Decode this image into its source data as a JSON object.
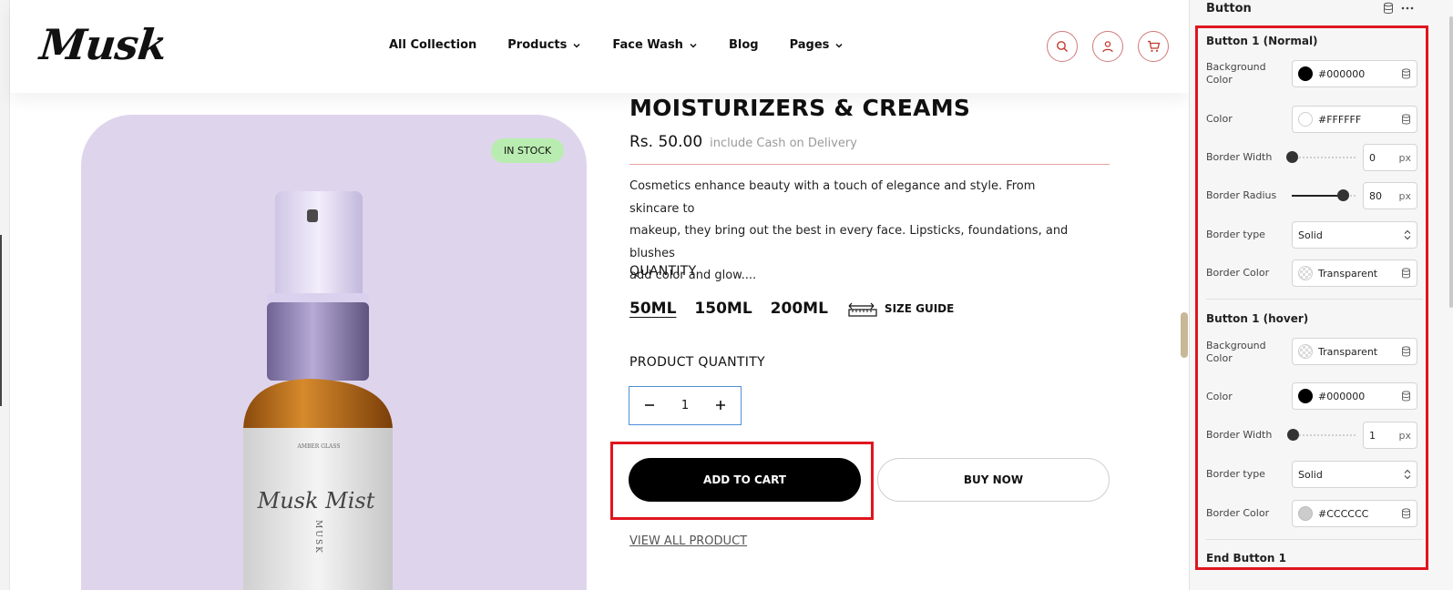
{
  "header": {
    "logo": "Musk",
    "nav": [
      {
        "label": "All Collection",
        "has_dropdown": false
      },
      {
        "label": "Products",
        "has_dropdown": true
      },
      {
        "label": "Face Wash",
        "has_dropdown": true
      },
      {
        "label": "Blog",
        "has_dropdown": false
      },
      {
        "label": "Pages",
        "has_dropdown": true
      }
    ],
    "icons": [
      "search-icon",
      "user-icon",
      "cart-icon"
    ]
  },
  "product": {
    "stock_badge": "IN STOCK",
    "title": "MOISTURIZERS & CREAMS",
    "price": "Rs. 50.00",
    "price_note": "include Cash on Delivery",
    "description_lines": [
      "Cosmetics enhance beauty with a touch of elegance and style. From skincare to",
      "makeup, they bring out the best in every face. Lipsticks, foundations, and blushes",
      "add color and glow...."
    ],
    "quantity_label": "QUANTITY",
    "sizes": [
      "50ML",
      "150ML",
      "200ML"
    ],
    "selected_size": "50ML",
    "size_guide": "SIZE GUIDE",
    "product_quantity_label": "PRODUCT QUANTITY",
    "quantity_value": "1",
    "add_to_cart": "ADD TO CART",
    "buy_now": "BUY NOW",
    "view_all": "VIEW ALL PRODUCT",
    "bottle_brand": "AMBER GLASS",
    "bottle_name": "Musk Mist",
    "bottle_vertical": "MUSK"
  },
  "panel": {
    "title": "Button",
    "normal": {
      "title": "Button 1 (Normal)",
      "background_color": {
        "label": "Background Color",
        "value": "#000000",
        "swatch": "#000000"
      },
      "color": {
        "label": "Color",
        "value": "#FFFFFF",
        "swatch": "#FFFFFF"
      },
      "border_width": {
        "label": "Border Width",
        "value": "0",
        "unit": "px",
        "level": 0
      },
      "border_radius": {
        "label": "Border Radius",
        "value": "80",
        "unit": "px",
        "level": 0.8
      },
      "border_type": {
        "label": "Border type",
        "value": "Solid"
      },
      "border_color": {
        "label": "Border Color",
        "value": "Transparent",
        "swatch": "transparent"
      }
    },
    "hover": {
      "title": "Button 1 (hover)",
      "background_color": {
        "label": "Background Color",
        "value": "Transparent",
        "swatch": "transparent"
      },
      "color": {
        "label": "Color",
        "value": "#000000",
        "swatch": "#000000"
      },
      "border_width": {
        "label": "Border Width",
        "value": "1",
        "unit": "px",
        "level": 0.01
      },
      "border_type": {
        "label": "Border type",
        "value": "Solid"
      },
      "border_color": {
        "label": "Border Color",
        "value": "#CCCCCC",
        "swatch": "#CCCCCC"
      }
    },
    "end_title": "End Button 1"
  },
  "colors": {
    "accent_red": "#e0151f",
    "image_bg": "#ded5ec",
    "stock_badge": "#b9ecb0",
    "stepper_border": "#4f8fd6"
  }
}
